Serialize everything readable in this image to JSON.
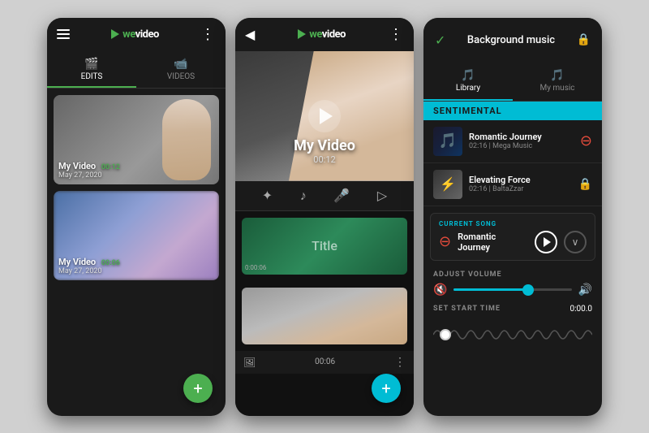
{
  "phone1": {
    "logo": "weVideo",
    "logo_we": "we",
    "logo_video": "video",
    "tabs": [
      {
        "label": "EDITS",
        "icon": "🎬",
        "active": true
      },
      {
        "label": "VIDEOS",
        "icon": "📹",
        "active": false
      }
    ],
    "videos": [
      {
        "title": "My Video",
        "duration": "00:12",
        "date": "May 27, 2020",
        "type": "gym"
      },
      {
        "title": "My Video",
        "duration": "00:06",
        "date": "May 27, 2020",
        "type": "blur"
      }
    ],
    "fab_icon": "+"
  },
  "phone2": {
    "logo": "weVideo",
    "video_title": "My Video",
    "video_duration": "00:12",
    "clip_title": "Title",
    "clip_time": "0:00:06",
    "clip_duration": "00:06",
    "fab_icon": "+"
  },
  "phone3": {
    "header_title": "Background music",
    "tabs": [
      {
        "label": "Library",
        "icon": "🎵",
        "active": true
      },
      {
        "label": "My music",
        "icon": "🎵",
        "active": false
      }
    ],
    "section": "SENTIMENTAL",
    "songs": [
      {
        "name": "Romantic Journey",
        "duration": "02:16",
        "label": "Mega Music",
        "action": "minus",
        "thumb_type": "dark-blue"
      },
      {
        "name": "Elevating Force",
        "duration": "02:16",
        "label": "BaltaZzar",
        "action": "lock",
        "thumb_type": "lightning"
      }
    ],
    "current_song_label": "CURRENT SONG",
    "current_song_name": "Romantic Journey",
    "adjust_volume_label": "ADJUST VOLUME",
    "set_start_time_label": "SET START TIME",
    "start_time_value": "0:00.0"
  }
}
